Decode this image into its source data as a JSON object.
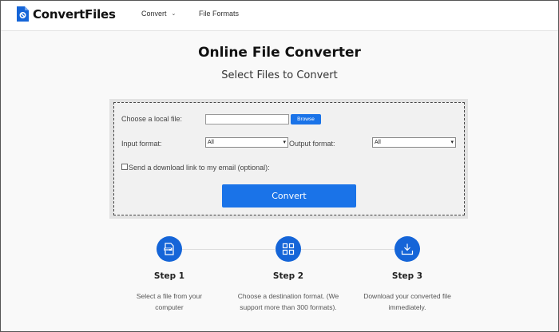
{
  "header": {
    "brand": "ConvertFiles",
    "nav": {
      "convert": "Convert",
      "file_formats": "File Formats"
    }
  },
  "main": {
    "title": "Online File Converter",
    "subtitle": "Select Files to Convert"
  },
  "form": {
    "local_file_label": "Choose a local file:",
    "local_file_value": "",
    "browse_label": "Browse",
    "input_format_label": "Input format:",
    "input_format_value": "All",
    "output_format_label": "Output format:",
    "output_format_value": "All",
    "email_link_label": "Send a download link to my email (optional):",
    "email_link_checked": false,
    "convert_label": "Convert"
  },
  "steps": [
    {
      "title": "Step 1",
      "description": "Select a file from your computer",
      "icon": "file-icon"
    },
    {
      "title": "Step 2",
      "description": "Choose a destination format. (We support more than 300 formats).",
      "icon": "grid-icon"
    },
    {
      "title": "Step 3",
      "description": "Download your converted file immediately.",
      "icon": "download-icon"
    }
  ],
  "colors": {
    "accent": "#1a73e8",
    "step_circle": "#1565d8"
  }
}
